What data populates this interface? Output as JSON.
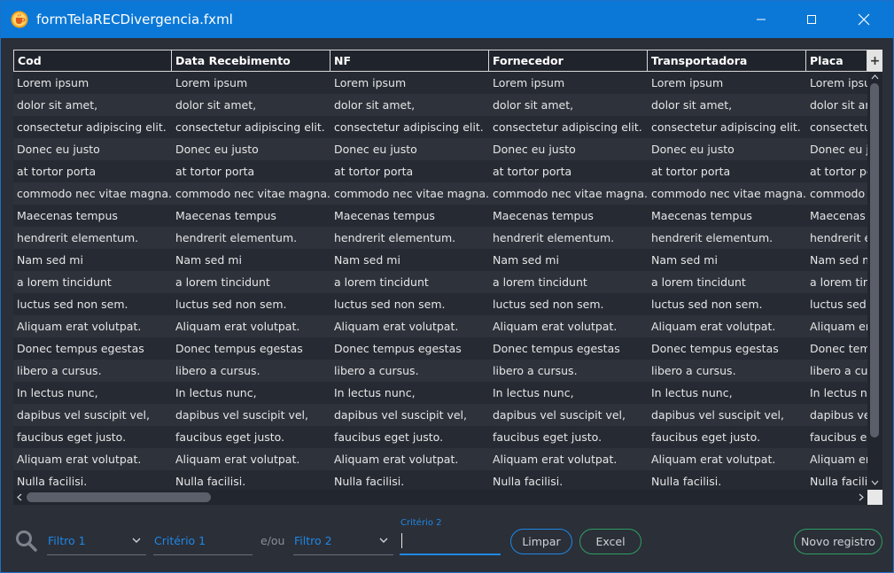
{
  "window": {
    "title": "formTelaRECDivergencia.fxml",
    "icons": {
      "app": "java-cup-icon",
      "minimize": "minimize-icon",
      "maximize": "maximize-icon",
      "close": "close-icon"
    }
  },
  "table": {
    "columns": [
      "Cod",
      "Data Recebimento",
      "NF",
      "Fornecedor",
      "Transportadora",
      "Placa"
    ],
    "column_menu_label": "+",
    "rows": [
      [
        "Lorem ipsum",
        "Lorem ipsum",
        "Lorem ipsum",
        "Lorem ipsum",
        "Lorem ipsum",
        "Lorem ipsum"
      ],
      [
        "dolor sit amet,",
        "dolor sit amet,",
        "dolor sit amet,",
        "dolor sit amet,",
        "dolor sit amet,",
        "dolor sit amet,"
      ],
      [
        "consectetur adipiscing elit.",
        "consectetur adipiscing elit.",
        "consectetur adipiscing elit.",
        "consectetur adipiscing elit.",
        "consectetur adipiscing elit.",
        "consectetur adipiscing elit."
      ],
      [
        "Donec eu justo",
        "Donec eu justo",
        "Donec eu justo",
        "Donec eu justo",
        "Donec eu justo",
        "Donec eu justo"
      ],
      [
        "at tortor porta",
        "at tortor porta",
        "at tortor porta",
        "at tortor porta",
        "at tortor porta",
        "at tortor porta"
      ],
      [
        "commodo nec vitae magna.",
        "commodo nec vitae magna.",
        "commodo nec vitae magna.",
        "commodo nec vitae magna.",
        "commodo nec vitae magna.",
        "commodo nec vitae magna."
      ],
      [
        "Maecenas tempus",
        "Maecenas tempus",
        "Maecenas tempus",
        "Maecenas tempus",
        "Maecenas tempus",
        "Maecenas tempus"
      ],
      [
        "hendrerit elementum.",
        "hendrerit elementum.",
        "hendrerit elementum.",
        "hendrerit elementum.",
        "hendrerit elementum.",
        "hendrerit elementum."
      ],
      [
        "Nam sed mi",
        "Nam sed mi",
        "Nam sed mi",
        "Nam sed mi",
        "Nam sed mi",
        "Nam sed mi"
      ],
      [
        "a lorem tincidunt",
        "a lorem tincidunt",
        "a lorem tincidunt",
        "a lorem tincidunt",
        "a lorem tincidunt",
        "a lorem tincidunt"
      ],
      [
        "luctus sed non sem.",
        "luctus sed non sem.",
        "luctus sed non sem.",
        "luctus sed non sem.",
        "luctus sed non sem.",
        "luctus sed non sem."
      ],
      [
        "Aliquam erat volutpat.",
        "Aliquam erat volutpat.",
        "Aliquam erat volutpat.",
        "Aliquam erat volutpat.",
        "Aliquam erat volutpat.",
        "Aliquam erat volutpat."
      ],
      [
        "Donec tempus egestas",
        "Donec tempus egestas",
        "Donec tempus egestas",
        "Donec tempus egestas",
        "Donec tempus egestas",
        "Donec tempus egestas"
      ],
      [
        "libero a cursus.",
        "libero a cursus.",
        "libero a cursus.",
        "libero a cursus.",
        "libero a cursus.",
        "libero a cursus."
      ],
      [
        "In lectus nunc,",
        "In lectus nunc,",
        "In lectus nunc,",
        "In lectus nunc,",
        "In lectus nunc,",
        "In lectus nunc,"
      ],
      [
        "dapibus vel suscipit vel,",
        "dapibus vel suscipit vel,",
        "dapibus vel suscipit vel,",
        "dapibus vel suscipit vel,",
        "dapibus vel suscipit vel,",
        "dapibus vel suscipit vel,"
      ],
      [
        "faucibus eget justo.",
        "faucibus eget justo.",
        "faucibus eget justo.",
        "faucibus eget justo.",
        "faucibus eget justo.",
        "faucibus eget justo."
      ],
      [
        "Aliquam erat volutpat.",
        "Aliquam erat volutpat.",
        "Aliquam erat volutpat.",
        "Aliquam erat volutpat.",
        "Aliquam erat volutpat.",
        "Aliquam erat volutpat."
      ],
      [
        "Nulla facilisi.",
        "Nulla facilisi.",
        "Nulla facilisi.",
        "Nulla facilisi.",
        "Nulla facilisi.",
        "Nulla facilisi."
      ]
    ]
  },
  "filters": {
    "search_icon": "search-icon",
    "filtro1": "Filtro 1",
    "criterio1": "Critério 1",
    "or_label": "e/ou",
    "filtro2": "Filtro 2",
    "criterio2_label": "Critério 2",
    "criterio2_value": "",
    "clear_button": "Limpar",
    "excel_button": "Excel",
    "new_record_button": "Novo registro"
  },
  "colors": {
    "titlebar": "#0b78d7",
    "accent": "#1e88e5",
    "success": "#2e9e62",
    "background": "#2b2f38"
  }
}
